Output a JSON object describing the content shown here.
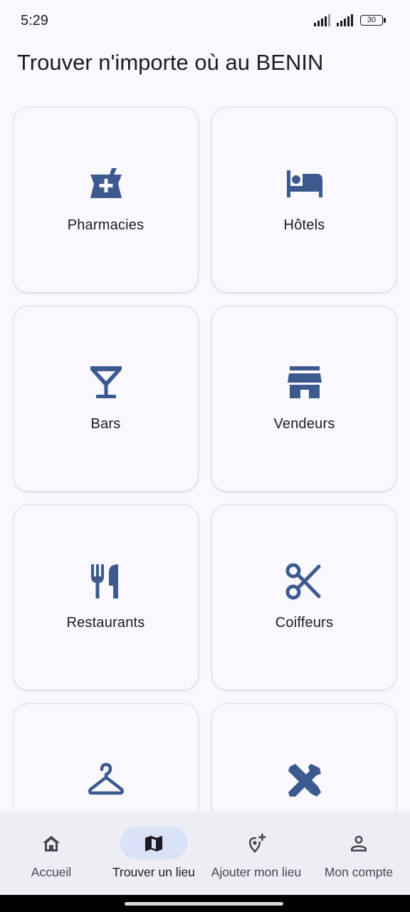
{
  "status_bar": {
    "time": "5:29",
    "battery": "30"
  },
  "page": {
    "title": "Trouver n'importe où au BENIN"
  },
  "categories": [
    {
      "label": "Pharmacies",
      "icon": "pharmacy-icon"
    },
    {
      "label": "Hôtels",
      "icon": "hotel-bed-icon"
    },
    {
      "label": "Bars",
      "icon": "cocktail-icon"
    },
    {
      "label": "Vendeurs",
      "icon": "storefront-icon"
    },
    {
      "label": "Restaurants",
      "icon": "restaurant-icon"
    },
    {
      "label": "Coiffeurs",
      "icon": "scissors-icon"
    },
    {
      "label": "",
      "icon": "hanger-icon"
    },
    {
      "label": "",
      "icon": "tools-icon"
    }
  ],
  "nav": {
    "items": [
      {
        "label": "Accueil",
        "icon": "home-icon",
        "active": false
      },
      {
        "label": "Trouver un lieu",
        "icon": "map-icon",
        "active": true
      },
      {
        "label": "Ajouter mon lieu",
        "icon": "add-location-icon",
        "active": false
      },
      {
        "label": "Mon compte",
        "icon": "person-icon",
        "active": false
      }
    ]
  },
  "colors": {
    "accent": "#3d5a8f",
    "background": "#f8f8fd",
    "nav_background": "#eceef4",
    "nav_active_pill": "#d9e2f7"
  }
}
